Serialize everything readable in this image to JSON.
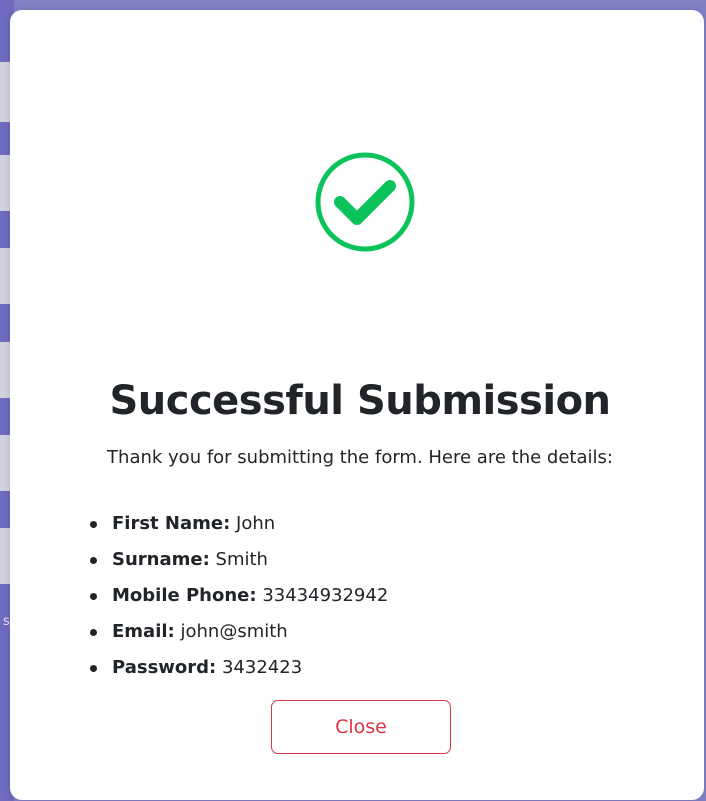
{
  "background": {
    "fragment_text": "s"
  },
  "modal": {
    "icon": "check-circle-icon",
    "accent_color": "#0bc35a",
    "title": "Successful Submission",
    "intro": "Thank you for submitting the form. Here are the details:",
    "details": [
      {
        "label": "First Name:",
        "value": "John"
      },
      {
        "label": "Surname:",
        "value": "Smith"
      },
      {
        "label": "Mobile Phone:",
        "value": "33434932942"
      },
      {
        "label": "Email:",
        "value": "john@smith"
      },
      {
        "label": "Password:",
        "value": "3432423"
      }
    ],
    "close_label": "Close",
    "close_color": "#dc3545"
  }
}
